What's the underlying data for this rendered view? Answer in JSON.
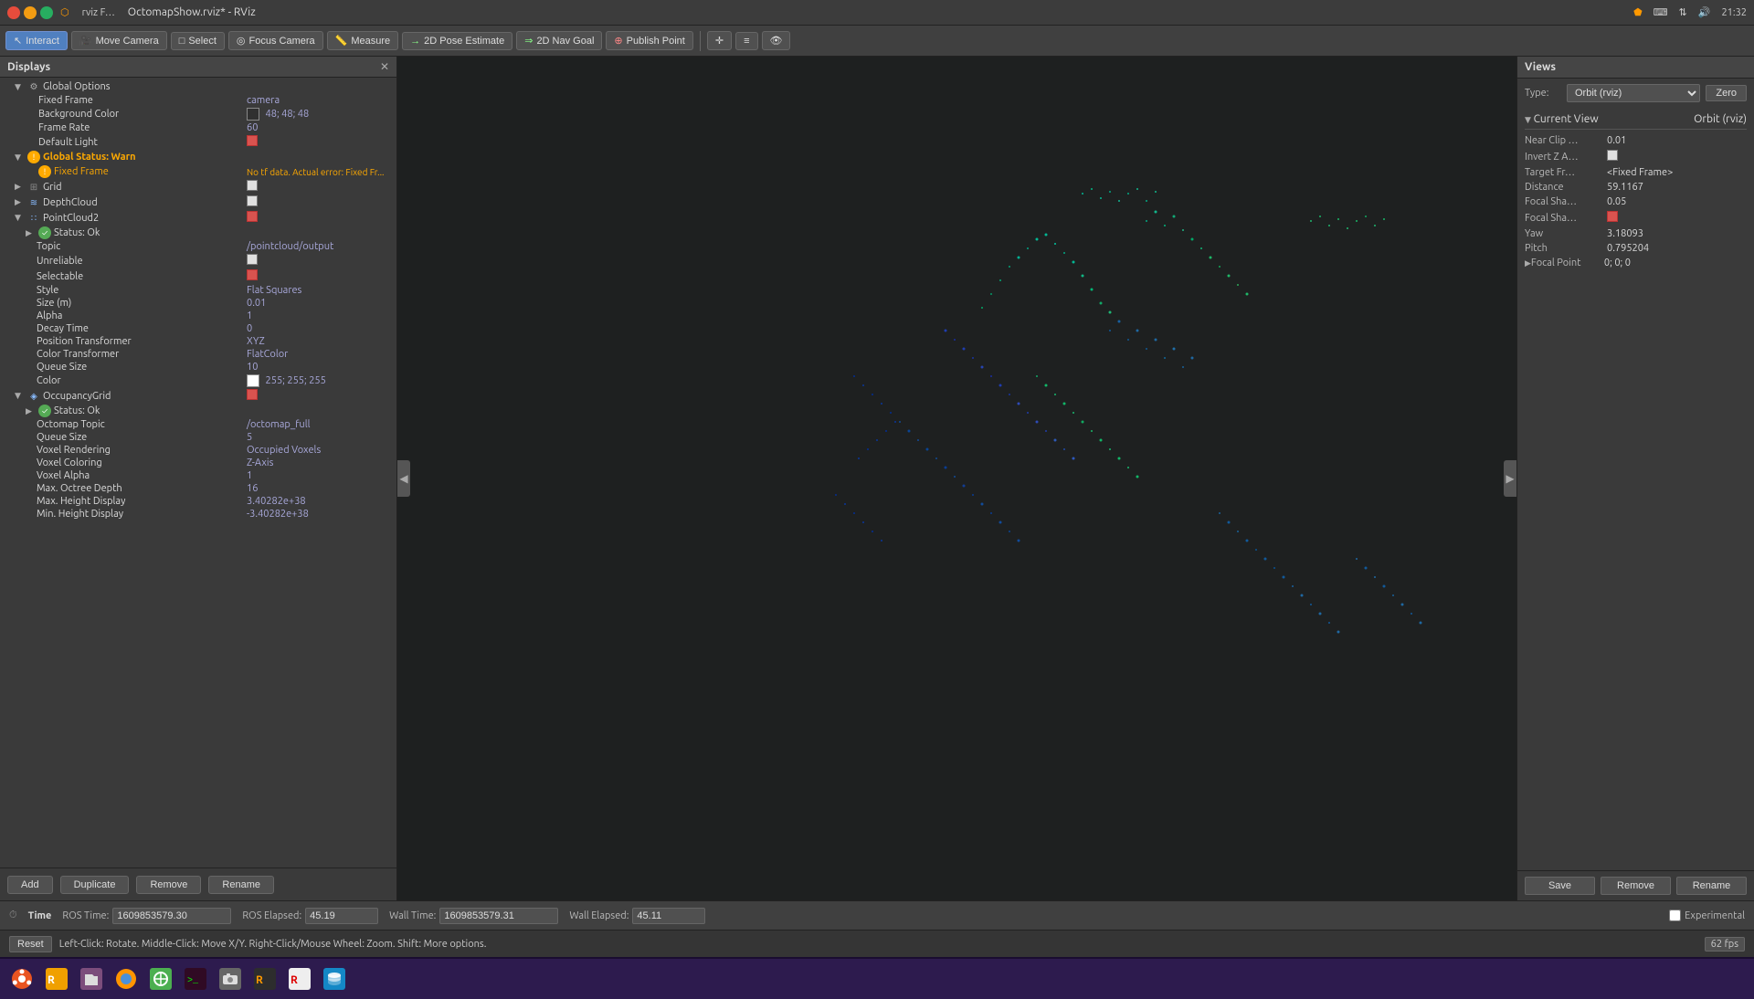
{
  "titlebar": {
    "title": "OctomapShow.rviz* - RViz",
    "time": "21:32"
  },
  "toolbar": {
    "interact_label": "Interact",
    "move_camera_label": "Move Camera",
    "select_label": "Select",
    "focus_camera_label": "Focus Camera",
    "measure_label": "Measure",
    "pose_estimate_label": "2D Pose Estimate",
    "nav_goal_label": "2D Nav Goal",
    "publish_point_label": "Publish Point"
  },
  "displays": {
    "header": "Displays",
    "global_options": {
      "label": "Global Options",
      "fixed_frame_label": "Fixed Frame",
      "fixed_frame_value": "camera",
      "bg_color_label": "Background Color",
      "bg_color_value": "48; 48; 48",
      "frame_rate_label": "Frame Rate",
      "frame_rate_value": "60",
      "default_light_label": "Default Light"
    },
    "global_status": {
      "label": "Global Status: Warn",
      "fixed_frame_label": "Fixed Frame",
      "fixed_frame_value": "No tf data. Actual error: Fixed Fr..."
    },
    "grid": {
      "label": "Grid"
    },
    "depth_cloud": {
      "label": "DepthCloud"
    },
    "point_cloud2": {
      "label": "PointCloud2",
      "status_label": "Status: Ok",
      "topic_label": "Topic",
      "topic_value": "/pointcloud/output",
      "unreliable_label": "Unreliable",
      "selectable_label": "Selectable",
      "style_label": "Style",
      "style_value": "Flat Squares",
      "size_label": "Size (m)",
      "size_value": "0.01",
      "alpha_label": "Alpha",
      "alpha_value": "1",
      "decay_time_label": "Decay Time",
      "decay_time_value": "0",
      "position_transformer_label": "Position Transformer",
      "position_transformer_value": "XYZ",
      "color_transformer_label": "Color Transformer",
      "color_transformer_value": "FlatColor",
      "queue_size_label": "Queue Size",
      "queue_size_value": "10",
      "color_label": "Color",
      "color_value": "255; 255; 255"
    },
    "occupancy_grid": {
      "label": "OccupancyGrid",
      "status_label": "Status: Ok",
      "octomap_topic_label": "Octomap Topic",
      "octomap_topic_value": "/octomap_full",
      "queue_size_label": "Queue Size",
      "queue_size_value": "5",
      "voxel_rendering_label": "Voxel Rendering",
      "voxel_rendering_value": "Occupied Voxels",
      "voxel_coloring_label": "Voxel Coloring",
      "voxel_coloring_value": "Z-Axis",
      "voxel_alpha_label": "Voxel Alpha",
      "voxel_alpha_value": "1",
      "max_octree_depth_label": "Max. Octree Depth",
      "max_octree_depth_value": "16",
      "max_height_label": "Max. Height Display",
      "max_height_value": "3.40282e+38",
      "min_height_label": "Min. Height Display",
      "min_height_value": "-3.40282e+38"
    },
    "buttons": {
      "add": "Add",
      "duplicate": "Duplicate",
      "remove": "Remove",
      "rename": "Rename"
    }
  },
  "views": {
    "header": "Views",
    "type_label": "Type:",
    "type_value": "Orbit (rviz)",
    "zero_label": "Zero",
    "current_view_label": "Current View",
    "current_view_type": "Orbit (rviz)",
    "near_clip_label": "Near Clip …",
    "near_clip_value": "0.01",
    "invert_z_label": "Invert Z A…",
    "target_frame_label": "Target Fr…",
    "target_frame_value": "<Fixed Frame>",
    "distance_label": "Distance",
    "distance_value": "59.1167",
    "focal_sha1_label": "Focal Sha…",
    "focal_sha1_value": "0.05",
    "focal_sha2_label": "Focal Sha…",
    "yaw_label": "Yaw",
    "yaw_value": "3.18093",
    "pitch_label": "Pitch",
    "pitch_value": "0.795204",
    "focal_point_label": "Focal Point",
    "focal_point_value": "0; 0; 0",
    "buttons": {
      "save": "Save",
      "remove": "Remove",
      "rename": "Rename"
    }
  },
  "timebar": {
    "label": "Time",
    "ros_time_label": "ROS Time:",
    "ros_time_value": "1609853579.30",
    "ros_elapsed_label": "ROS Elapsed:",
    "ros_elapsed_value": "45.19",
    "wall_time_label": "Wall Time:",
    "wall_time_value": "1609853579.31",
    "wall_elapsed_label": "Wall Elapsed:",
    "wall_elapsed_value": "45.11",
    "experimental_label": "Experimental"
  },
  "statusbar": {
    "reset_label": "Reset",
    "help_text": "Left-Click: Rotate. Middle-Click: Move X/Y. Right-Click/Mouse Wheel: Zoom. Shift: More options.",
    "fps": "62 fps"
  },
  "taskbar": {
    "icons": [
      "ubuntu",
      "rviz-yellow",
      "files",
      "firefox",
      "web",
      "terminal",
      "camera",
      "rviz-dark",
      "rviz-light",
      "database"
    ]
  }
}
